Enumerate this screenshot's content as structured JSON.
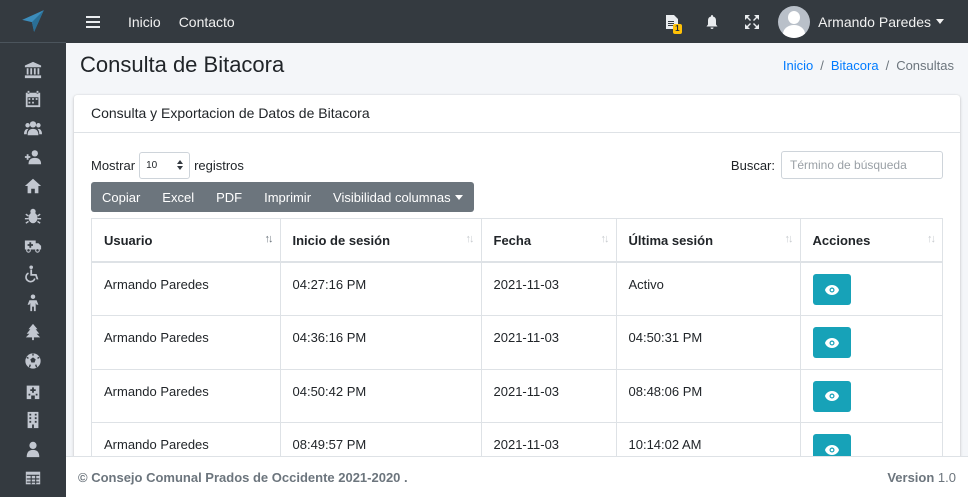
{
  "topbar": {
    "nav": [
      "Inicio",
      "Contacto"
    ],
    "notification_badge": "1",
    "user_name": "Armando Paredes"
  },
  "sidebar": {
    "icons": [
      "bank-icon",
      "calendar-icon",
      "users-icon",
      "user-plus-icon",
      "home-icon",
      "bug-icon",
      "ambulance-icon",
      "wheelchair-icon",
      "child-icon",
      "tree-icon",
      "soccer-ball-icon",
      "hospital-icon",
      "building-icon",
      "user-icon",
      "table-icon"
    ]
  },
  "header": {
    "title": "Consulta de Bitacora",
    "breadcrumb": [
      "Inicio",
      "Bitacora",
      "Consultas"
    ]
  },
  "card": {
    "title": "Consulta y Exportacion de Datos de Bitacora",
    "length_label_pre": "Mostrar",
    "length_value": "10",
    "length_label_post": "registros",
    "search_label": "Buscar:",
    "search_placeholder": "Término de búsqueda",
    "buttons": [
      "Copiar",
      "Excel",
      "PDF",
      "Imprimir",
      "Visibilidad columnas"
    ]
  },
  "table": {
    "columns": [
      "Usuario",
      "Inicio de sesión",
      "Fecha",
      "Última sesión",
      "Acciones"
    ],
    "rows": [
      [
        "Armando Paredes",
        "04:27:16 PM",
        "2021-11-03",
        "Activo"
      ],
      [
        "Armando Paredes",
        "04:36:16 PM",
        "2021-11-03",
        "04:50:31 PM"
      ],
      [
        "Armando Paredes",
        "04:50:42 PM",
        "2021-11-03",
        "08:48:06 PM"
      ],
      [
        "Armando Paredes",
        "08:49:57 PM",
        "2021-11-03",
        "10:14:02 AM"
      ]
    ]
  },
  "footer": {
    "copyright": "© Consejo Comunal Prados de Occidente 2021-2020 .",
    "version_label": "Version",
    "version_number": "1.0"
  },
  "colors": {
    "sidebar_bg": "#343a40",
    "accent_link": "#007bff",
    "action_button": "#17a2b8",
    "button_group": "#6c757d"
  }
}
